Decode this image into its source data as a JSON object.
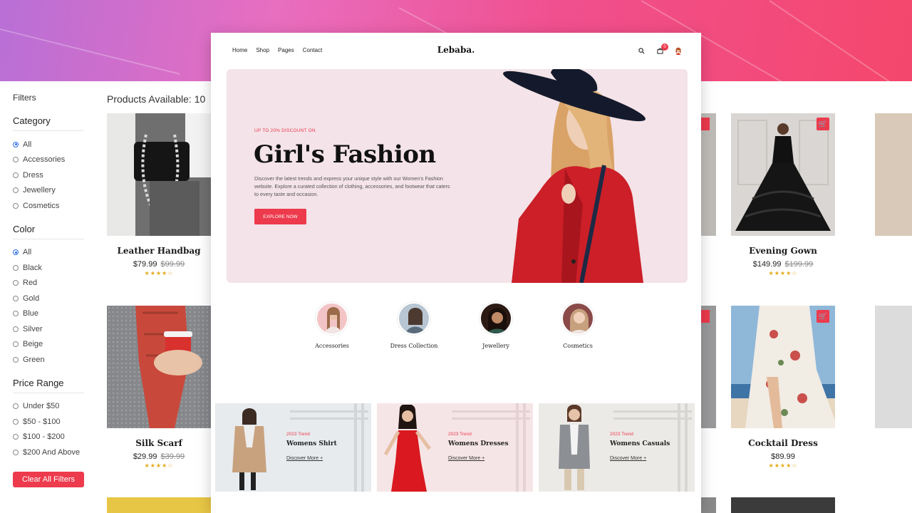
{
  "filters": {
    "title": "Filters",
    "category": {
      "title": "Category",
      "options": [
        "All",
        "Accessories",
        "Dress",
        "Jewellery",
        "Cosmetics"
      ]
    },
    "color": {
      "title": "Color",
      "options": [
        "All",
        "Black",
        "Red",
        "Gold",
        "Blue",
        "Silver",
        "Beige",
        "Green"
      ]
    },
    "price": {
      "title": "Price Range",
      "options": [
        "Under $50",
        "$50 - $100",
        "$100 - $200",
        "$200 And Above"
      ]
    },
    "clear_label": "Clear All Filters"
  },
  "products_title": "Products Available: 10",
  "products": [
    {
      "name": "Leather Handbag",
      "price": "$79.99",
      "old_price": "$99.99",
      "stars": "★★★★☆"
    },
    {
      "name": "Evening Gown",
      "price": "$149.99",
      "old_price": "$199.99",
      "stars": "★★★★☆"
    },
    {
      "name": "Silk Scarf",
      "price": "$29.99",
      "old_price": "$39.99",
      "stars": "★★★★☆"
    },
    {
      "name": "Cocktail Dress",
      "price": "$89.99",
      "old_price": "",
      "stars": "★★★★☆"
    }
  ],
  "site": {
    "nav": [
      "Home",
      "Shop",
      "Pages",
      "Contact"
    ],
    "logo": "Lebaba.",
    "cart_count": "0",
    "hero": {
      "kicker": "UP TO 20% DISCOUNT ON",
      "headline": "Girl's Fashion",
      "desc": "Discover the latest trends and express your unique style with our Women's Fashion website. Explore a curated collection of clothing, accessories, and footwear that caters to every taste and occasion.",
      "button": "EXPLORE NOW"
    },
    "categories": [
      "Accessories",
      "Dress Collection",
      "Jewellery",
      "Cosmetics"
    ],
    "trends": [
      {
        "tag": "2023 Trend",
        "name": "Womens Shirt",
        "link": "Discover More +"
      },
      {
        "tag": "2023 Trend",
        "name": "Womens Dresses",
        "link": "Discover More +"
      },
      {
        "tag": "2023 Trend",
        "name": "Womens Casuals",
        "link": "Discover More +"
      }
    ]
  },
  "colors": {
    "accent": "#ed3a4d",
    "hero_bg": "#f4e3e8"
  }
}
